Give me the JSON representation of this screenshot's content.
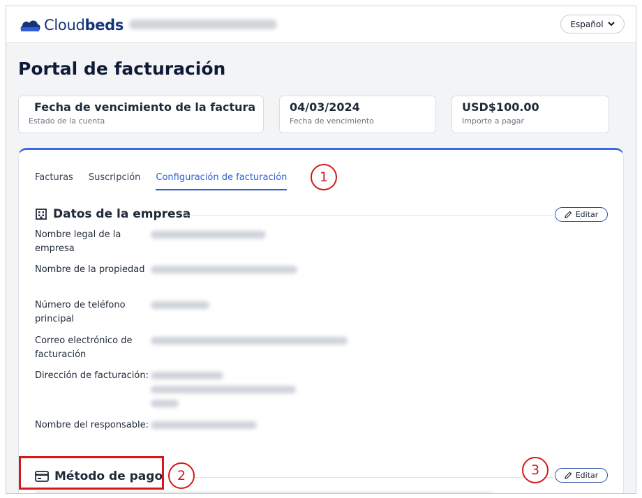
{
  "header": {
    "logo_text_a": "Cloud",
    "logo_text_b": "beds",
    "property_name": "",
    "language_label": "Español"
  },
  "page": {
    "title": "Portal de facturación"
  },
  "status_cards": [
    {
      "value": "Fecha de vencimiento de la factura",
      "label": "Estado de la cuenta",
      "dot_color": "#f5b800"
    },
    {
      "value": "04/03/2024",
      "label": "Fecha de vencimiento"
    },
    {
      "value": "USD$100.00",
      "label": "Importe a pagar"
    }
  ],
  "tabs": [
    {
      "label": "Facturas",
      "active": false
    },
    {
      "label": "Suscripción",
      "active": false
    },
    {
      "label": "Configuración de facturación",
      "active": true
    }
  ],
  "company_section": {
    "title": "Datos de la empresa",
    "edit_label": "Editar",
    "rows": [
      {
        "label": "Nombre legal de la empresa",
        "value": ""
      },
      {
        "label": "Nombre de la propiedad",
        "value": ""
      },
      {
        "label": "Número de teléfono principal",
        "value": ""
      },
      {
        "label": "Correo electrónico de facturación",
        "value": ""
      },
      {
        "label": "Dirección de facturación:",
        "value": ""
      },
      {
        "label": "Nombre del responsable:",
        "value": ""
      }
    ]
  },
  "payment_section": {
    "title": "Método de pago",
    "edit_label": "Editar"
  },
  "annotations": [
    "1",
    "2",
    "3"
  ],
  "colors": {
    "accent": "#2f5fd0",
    "annotation": "#d31919",
    "brand": "#16347a",
    "status_dot": "#f5b800"
  }
}
